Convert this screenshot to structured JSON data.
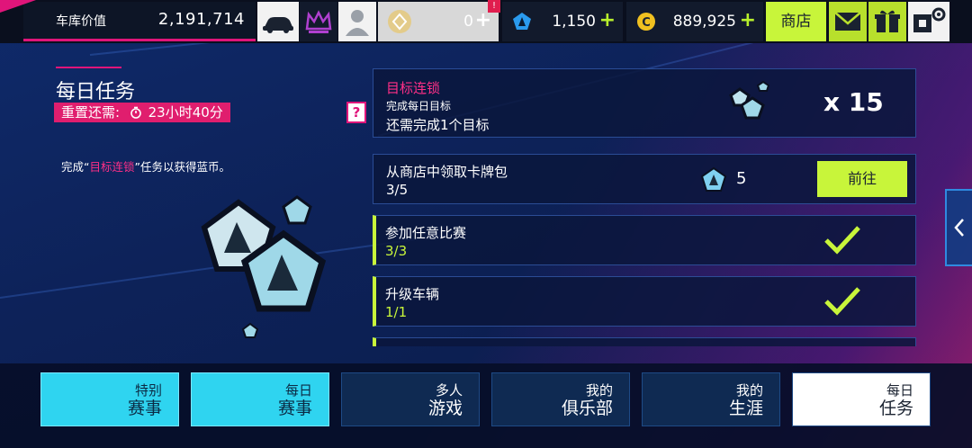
{
  "topbar": {
    "garage_label": "车库价值",
    "garage_value": "2,191,714",
    "tokens": "0",
    "token_alert": "!",
    "blueprints": "1,150",
    "credits": "889,925",
    "shop_label": "商店",
    "plus": "+"
  },
  "daily": {
    "title": "每日任务",
    "reset_label": "重置还需:",
    "reset_time": "23小时40分",
    "desc_before": "完成“",
    "desc_highlight": "目标连锁",
    "desc_after": "”任务以获得蓝币。"
  },
  "tasks": [
    {
      "title": "目标连锁",
      "subtitle": "完成每日目标",
      "progress": "还需完成1个目标",
      "reward": "x 15",
      "help": "?"
    },
    {
      "title": "从商店中领取卡牌包",
      "progress": "3/5",
      "reward": "5",
      "button": "前往"
    },
    {
      "title": "参加任意比赛",
      "progress": "3/3",
      "status": "done"
    },
    {
      "title": "升级车辆",
      "progress": "1/1",
      "status": "done"
    }
  ],
  "tabs": [
    {
      "line1": "特别",
      "line2": "赛事"
    },
    {
      "line1": "每日",
      "line2": "赛事"
    },
    {
      "line1": "多人",
      "line2": "游戏"
    },
    {
      "line1": "我的",
      "line2": "俱乐部"
    },
    {
      "line1": "我的",
      "line2": "生涯"
    },
    {
      "line1": "每日",
      "line2": "任务"
    }
  ],
  "colors": {
    "accent_lime": "#c8f53a",
    "accent_pink": "#e0157a",
    "accent_cyan": "#2fd4f0"
  },
  "icons": [
    "car-icon",
    "crown-icon",
    "avatar-icon",
    "token-icon",
    "blueprint-icon",
    "credit-icon",
    "mail-icon",
    "gift-icon",
    "settings-icon",
    "token-stack-icon",
    "check-icon",
    "chevron-left-icon"
  ]
}
